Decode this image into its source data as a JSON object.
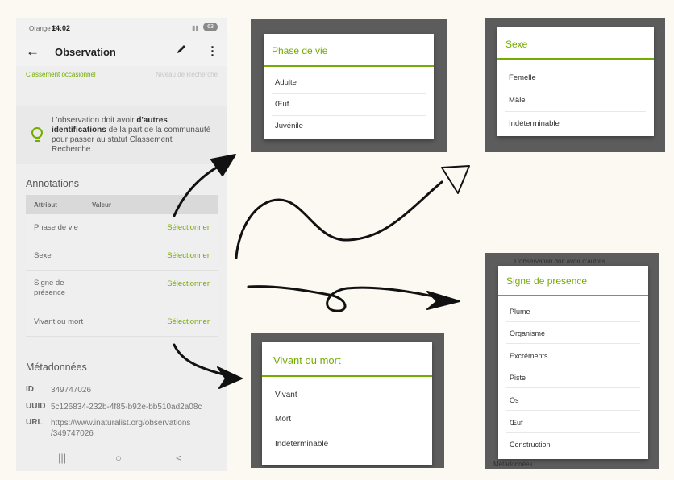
{
  "phone": {
    "status": {
      "carrier": "Orange F",
      "time": "14:02",
      "battery": "63"
    },
    "appbar": {
      "back_icon": "←",
      "title": "Observation",
      "edit_icon": "pencil-icon",
      "more_icon": "⋮"
    },
    "grade": {
      "casual": "Classement occasionnel",
      "research": "Niveau de Recherche"
    },
    "notice": {
      "text_before": "L'observation doit avoir ",
      "bold": "d'autres identifications",
      "text_after": " de la part de la communauté pour passer au statut Classement Recherche."
    },
    "annotations": {
      "title": "Annotations",
      "col_attribute": "Attribut",
      "col_value": "Valeur",
      "rows": [
        {
          "attribute": "Phase de vie",
          "action": "Sélectionner"
        },
        {
          "attribute": "Sexe",
          "action": "Sélectionner"
        },
        {
          "attribute": "Signe de présence",
          "action": "Sélectionner"
        },
        {
          "attribute": "Vivant ou mort",
          "action": "Sélectionner"
        }
      ]
    },
    "metadata": {
      "title": "Métadonnées",
      "id_key": "ID",
      "id_value": "349747026",
      "uuid_key": "UUID",
      "uuid_value": "5c126834-232b-4f85-b92e-bb510ad2a08c",
      "url_key": "URL",
      "url_value": "https://www.inaturalist.org/observations /349747026"
    },
    "navbar": {
      "recent": "|||",
      "home": "○",
      "back": "<"
    }
  },
  "dialogs": {
    "phase": {
      "title": "Phase de vie",
      "options": [
        "Adulte",
        "Œuf",
        "Juvénile"
      ]
    },
    "sexe": {
      "title": "Sexe",
      "options": [
        "Femelle",
        "Mâle",
        "Indéterminable"
      ]
    },
    "signe": {
      "title": "Signe de presence",
      "options": [
        "Plume",
        "Organisme",
        "Excréments",
        "Piste",
        "Os",
        "Œuf",
        "Construction"
      ],
      "bg_top": "L'observation doit avoir d'autres",
      "bg_bottom": "Métadonnées"
    },
    "vivant": {
      "title": "Vivant ou mort",
      "options": [
        "Vivant",
        "Mort",
        "Indéterminable"
      ]
    }
  },
  "colors": {
    "accent": "#74ac00",
    "background": "#fcf9f3",
    "scrim": "#5c5c5c"
  }
}
